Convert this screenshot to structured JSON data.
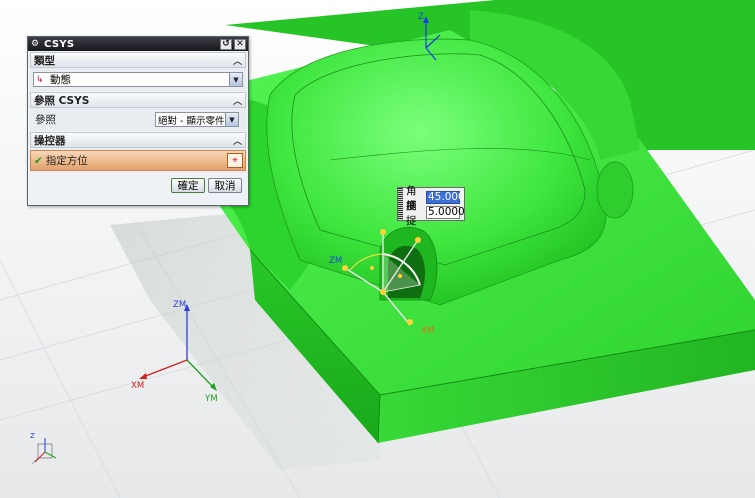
{
  "dialog": {
    "title": "CSYS",
    "sections": {
      "type": {
        "title": "類型",
        "value": "動態"
      },
      "reference": {
        "title": "參照 CSYS",
        "label": "參照",
        "value": "絕對 - 顯示零件"
      },
      "manipulator": {
        "title": "操控器",
        "item": "指定方位"
      }
    },
    "ok_label": "確定",
    "cancel_label": "取消"
  },
  "angle_input": {
    "angle_label": "角度",
    "angle_value": "45.000",
    "snap_label": "捕捉",
    "snap_value": "5.0000"
  },
  "axes": {
    "top_z": "Z",
    "zm": "ZM",
    "xm": "XM",
    "ym": "YM",
    "wcs_zm": "ZM",
    "wcs_xm": "XM",
    "wcs_ym": "YM",
    "view_z": "Z"
  },
  "colors": {
    "model_green": "#3fe03f",
    "dialog_accent": "#e4a06a",
    "selection_blue": "#3d6fd6"
  },
  "icons": {
    "gear": "gear-icon",
    "reset": "reset-icon",
    "close": "close-icon",
    "dynamic": "dynamic-csys-icon",
    "check": "check-icon",
    "orient": "orient-manipulator-icon"
  }
}
